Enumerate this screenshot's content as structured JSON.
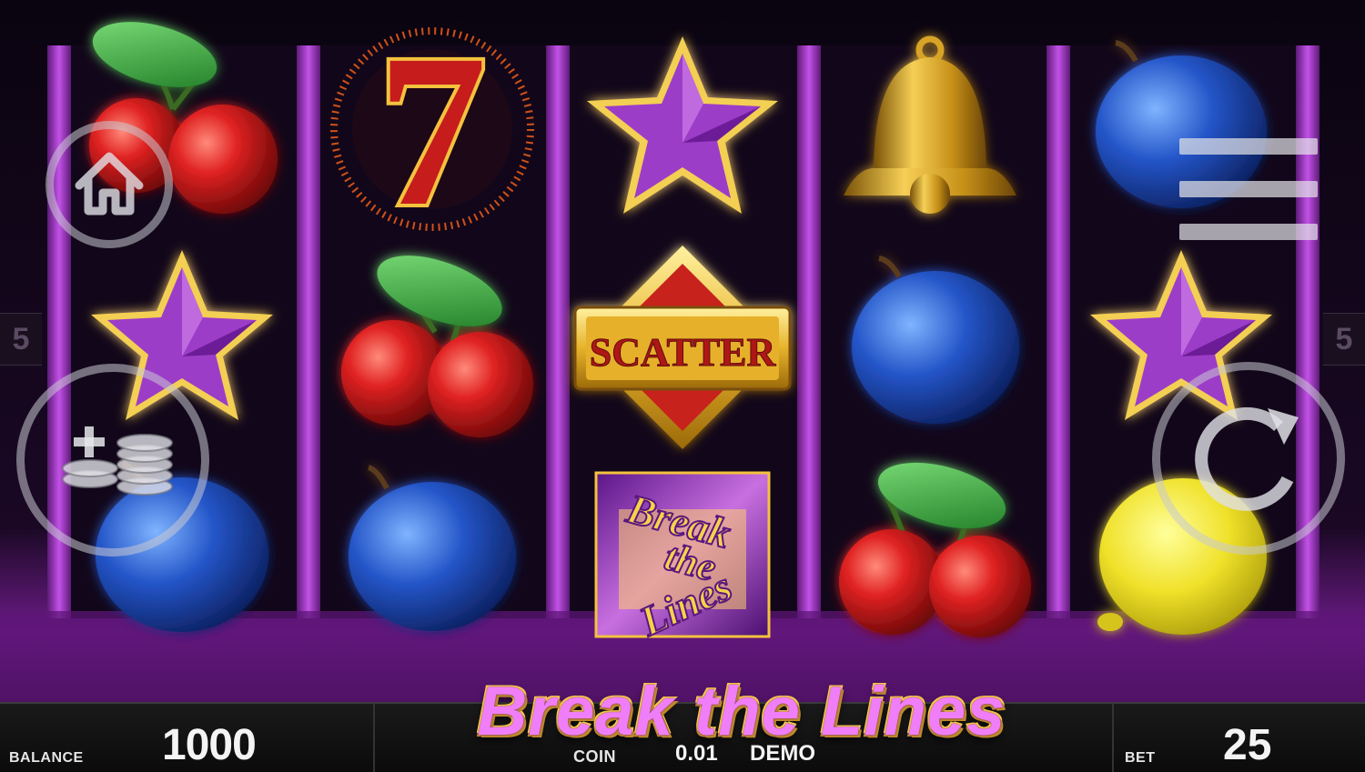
{
  "game": {
    "title": "Break the Lines",
    "left_line_count": "5",
    "right_line_count": "5"
  },
  "reels": {
    "columns": [
      [
        "cherry",
        "star",
        "plum"
      ],
      [
        "seven",
        "cherry",
        "plum"
      ],
      [
        "star",
        "scatter",
        "break-the-lines-wild"
      ],
      [
        "bell",
        "plum",
        "cherry"
      ],
      [
        "plum",
        "star",
        "lemon"
      ]
    ],
    "scatter_label": "SCATTER",
    "wild_label_lines": [
      "Break",
      "the",
      "Lines"
    ],
    "seven_glyph": "7"
  },
  "hud": {
    "home_icon": "home-icon",
    "bet_icon": "coins-plus-icon",
    "spin_icon": "spin-arrow-icon",
    "menu_icon": "hamburger-menu-icon",
    "bet_plus_glyph": "+"
  },
  "bottom_bar": {
    "balance_label": "BALANCE",
    "balance_value": "1000",
    "coin_label": "COIN",
    "coin_value": "0.01",
    "mode_label": "DEMO",
    "bet_label": "BET",
    "bet_value": "25"
  },
  "colors": {
    "reel_divider": "#a02ec2",
    "reel_bg": "#12071a",
    "title_pink": "#f07ef8",
    "title_gold": "#ffd24a",
    "cherry_red": "#d61f1f",
    "plum_blue": "#1f54c9",
    "star_purple": "#9c3cc8",
    "bell_gold": "#d8a326",
    "lemon_yellow": "#f1e232",
    "seven_red": "#c61c1c"
  }
}
